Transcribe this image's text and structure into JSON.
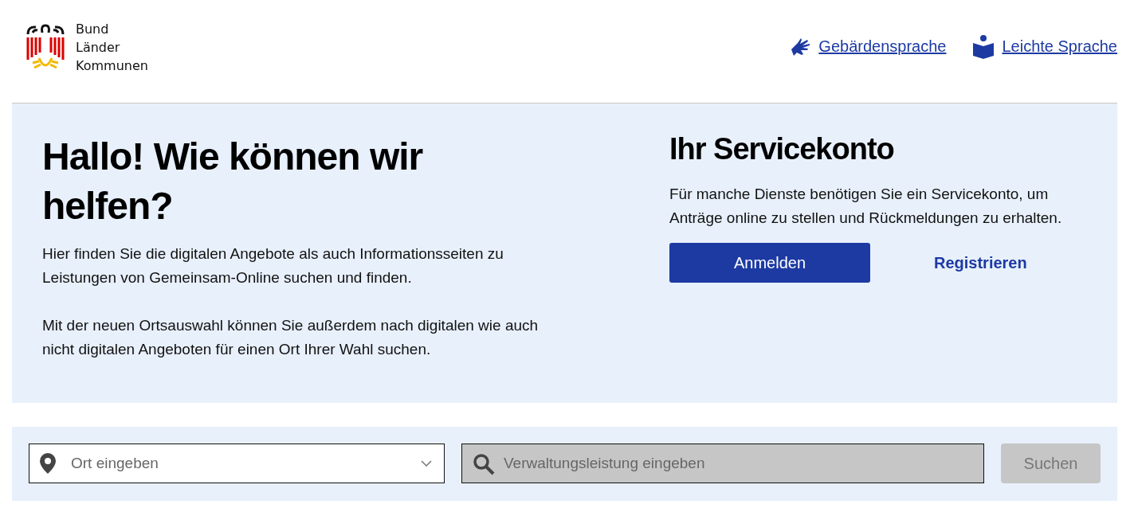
{
  "logo": {
    "lines": [
      "Bund",
      "Länder",
      "Kommunen"
    ]
  },
  "header_links": [
    {
      "label": "Gebärdensprache",
      "kind": "sign"
    },
    {
      "label": "Leichte Sprache",
      "kind": "book"
    }
  ],
  "hero": {
    "title": "Hallo! Wie können wir helfen?",
    "paragraphs": [
      "Hier finden Sie die digitalen Angebote als auch Informationsseiten zu Leistungen von Gemeinsam-Online suchen und finden.",
      "Mit der neuen Ortsauswahl können Sie außerdem nach digitalen wie auch nicht digitalen Angeboten für einen Ort Ihrer Wahl suchen."
    ]
  },
  "service_account": {
    "title": "Ihr Servicekonto",
    "text": "Für manche Dienste benötigen Sie ein Servicekonto, um Anträge online zu stellen und Rückmeldungen zu erhalten.",
    "login_button": "Anmelden",
    "register_link": "Registrieren"
  },
  "search": {
    "location": {
      "placeholder": "Ort eingeben"
    },
    "service": {
      "placeholder": "Verwaltungsleistung eingeben",
      "disabled": true
    },
    "button": {
      "label": "Suchen",
      "disabled": true
    }
  }
}
